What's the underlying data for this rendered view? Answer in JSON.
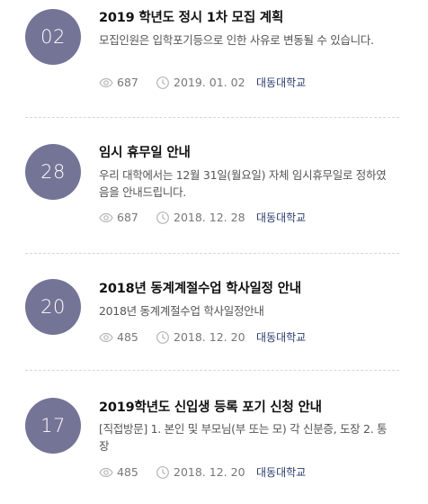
{
  "notices": [
    {
      "number": "02",
      "title": "2019 학년도 정시 1차 모집 계획",
      "description": "모집인원은 입학포기등으로 인한 사유로  변동될 수 있습니다.",
      "views": "687",
      "date": "2019. 01. 02",
      "author": "대동대학교"
    },
    {
      "number": "28",
      "title": "임시 휴무일 안내",
      "description": "우리 대학에서는 12월 31일(월요일) 자체 임시휴무일로 정하였음을 안내드립니다.",
      "views": "687",
      "date": "2018. 12. 28",
      "author": "대동대학교"
    },
    {
      "number": "20",
      "title": "2018년 동계계절수업 학사일정 안내",
      "description": "2018년 동계계절수업 학사일정안내",
      "views": "485",
      "date": "2018. 12. 20",
      "author": "대동대학교"
    },
    {
      "number": "17",
      "title": "2019학년도 신입생 등록 포기 신청 안내",
      "description": "[직접방문] 1. 본인 및 부모님(부 또는 모) 각 신분증, 도장 2. 통장",
      "views": "485",
      "date": "2018. 12. 20",
      "author": "대동대학교"
    }
  ],
  "icons": {
    "views": "eye-icon",
    "date": "clock-icon"
  },
  "colors": {
    "circle": "#747497",
    "author": "#2a3b6b"
  }
}
